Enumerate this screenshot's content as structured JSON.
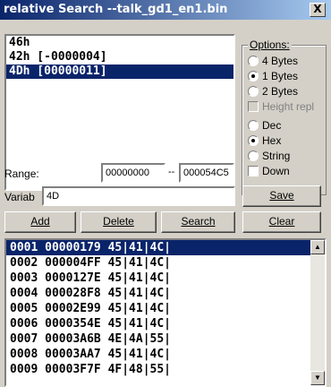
{
  "window": {
    "title": "relative Search --talk_gd1_en1.bin",
    "close_label": "X"
  },
  "hex_list": [
    {
      "text": "46h"
    },
    {
      "text": "42h [-0000004]"
    },
    {
      "text": "4Dh [00000011]"
    }
  ],
  "options": {
    "title": "Options:",
    "size_radios": [
      {
        "label": "4 Bytes",
        "checked": false
      },
      {
        "label": "1 Bytes",
        "checked": true
      },
      {
        "label": "2 Bytes",
        "checked": false
      }
    ],
    "height_repl": {
      "label": "Height repl",
      "checked": false,
      "disabled": true
    },
    "format_radios": [
      {
        "label": "Dec",
        "checked": false
      },
      {
        "label": "Hex",
        "checked": true
      },
      {
        "label": "String",
        "checked": false
      }
    ],
    "down": {
      "label": "Down",
      "checked": false
    }
  },
  "range": {
    "label": "Range:",
    "from": "00000000",
    "sep": "--",
    "to": "000054C5"
  },
  "variab": {
    "label": "Variab",
    "value": "4D"
  },
  "buttons": {
    "save": "Save",
    "add": "Add",
    "delete": "Delete",
    "search": "Search",
    "clear": "Clear"
  },
  "results": [
    {
      "text": "0001 00000179 45|41|4C|"
    },
    {
      "text": "0002 000004FF 45|41|4C|"
    },
    {
      "text": "0003 0000127E 45|41|4C|"
    },
    {
      "text": "0004 000028F8 45|41|4C|"
    },
    {
      "text": "0005 00002E99 45|41|4C|"
    },
    {
      "text": "0006 0000354E 45|41|4C|"
    },
    {
      "text": "0007 00003A6B 4E|4A|55|"
    },
    {
      "text": "0008 00003AA7 45|41|4C|"
    },
    {
      "text": "0009 00003F7F 4F|48|55|"
    }
  ],
  "scrollbar": {
    "up_icon": "up-arrow",
    "down_icon": "down-arrow"
  }
}
